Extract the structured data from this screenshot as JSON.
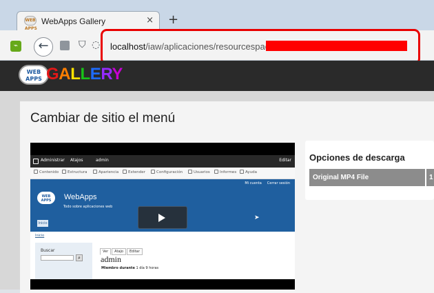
{
  "browser": {
    "tab_title": "WebApps Gallery",
    "tab_icon_text": "WEB APPS",
    "tab_close": "×",
    "new_tab": "+",
    "url_host": "localhost",
    "url_path": "/iaw/aplicaciones/resourcespace/",
    "back_icon": "←",
    "page_icon": "page-icon",
    "shield_icon": "shield-icon",
    "globe_icon": "globe-icon",
    "accent_colors": {
      "highlight": "#e90000",
      "redaction": "#ff0000",
      "menu_icon": "#66a91a"
    }
  },
  "site": {
    "logo_cloud_text": "WEB APPS",
    "logo_letters": [
      "G",
      "A",
      "L",
      "L",
      "E",
      "R",
      "Y"
    ]
  },
  "resource": {
    "title": "Cambiar de sitio el menú",
    "download": {
      "title": "Opciones de descarga",
      "file_label": "Original MP4 File",
      "partial_value": "1"
    }
  },
  "video_frame": {
    "admin_items": [
      "Administrar",
      "Atajos",
      "admin"
    ],
    "edit_label": "Editar",
    "toolbar_items": [
      "Contenido",
      "Estructura",
      "Apariencia",
      "Extender",
      "Configuración",
      "Usuarios",
      "Informes",
      "Ayuda"
    ],
    "site_links": [
      "Mi cuenta",
      "Cerrar sesión"
    ],
    "logo_text": "WEB APPS",
    "site_name": "WebApps",
    "slogan": "Todo sobre aplicaciones web",
    "home_tab": "Inicio",
    "breadcrumb": "Inicio",
    "search_label": "Buscar",
    "search_button": "⌕",
    "tabs": [
      "Ver",
      "Atajo",
      "Editar"
    ],
    "heading": "admin",
    "meta_strong": "Miembro durante",
    "meta_value": "1 día 9 horas"
  }
}
